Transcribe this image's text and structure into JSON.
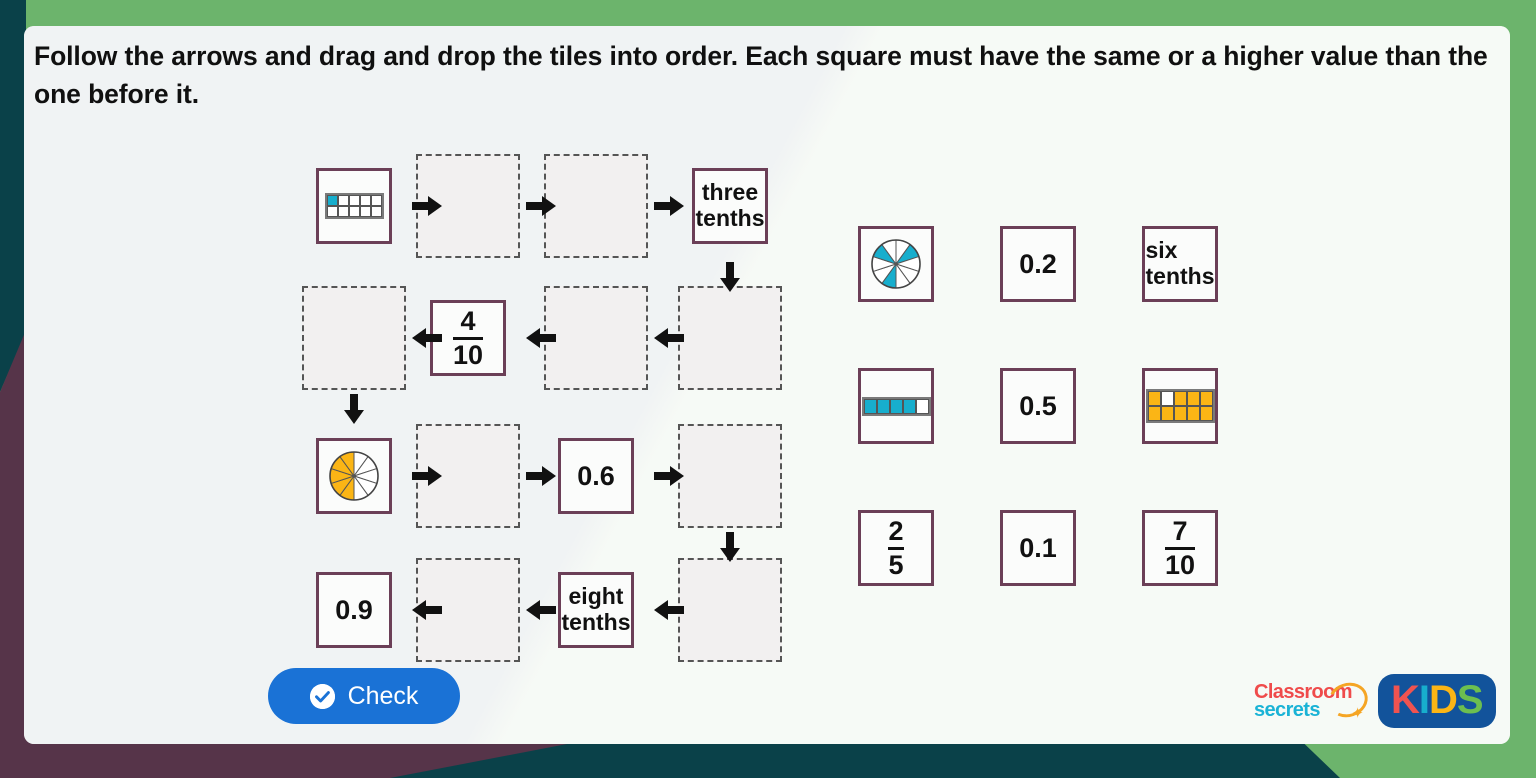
{
  "page": {
    "background_color": "#6cb46c",
    "card_color": "#f7f9f7",
    "accent_purple": "#6b3f57",
    "accent_teal": "#0a4149",
    "accent_plum": "#563449"
  },
  "instruction": {
    "text": "Follow the arrows and drag and drop the tiles into order. Each square must have the same or a higher value than the one before it."
  },
  "flow": {
    "rows": [
      {
        "direction": "right",
        "cells": [
          {
            "kind": "model-grid",
            "state": "filled",
            "model": "grid-10-cyan",
            "filled_count": 1,
            "total": 10,
            "value": "0.1"
          },
          {
            "kind": "blank",
            "state": "empty",
            "label": ""
          },
          {
            "kind": "blank",
            "state": "empty",
            "label": ""
          },
          {
            "kind": "words",
            "state": "filled",
            "label": "three tenths",
            "line1": "three",
            "line2": "tenths"
          }
        ]
      },
      {
        "direction": "left",
        "cells": [
          {
            "kind": "blank",
            "state": "empty",
            "label": ""
          },
          {
            "kind": "fraction",
            "state": "filled",
            "numerator": "4",
            "denominator": "10"
          },
          {
            "kind": "blank",
            "state": "empty",
            "label": ""
          },
          {
            "kind": "blank",
            "state": "empty",
            "label": ""
          }
        ]
      },
      {
        "direction": "right",
        "cells": [
          {
            "kind": "model-pie",
            "state": "filled",
            "model": "pie-10-orange",
            "filled_count": 5,
            "total": 10,
            "value": "0.5"
          },
          {
            "kind": "blank",
            "state": "empty",
            "label": ""
          },
          {
            "kind": "decimal",
            "state": "filled",
            "label": "0.6"
          },
          {
            "kind": "blank",
            "state": "empty",
            "label": ""
          }
        ]
      },
      {
        "direction": "left",
        "cells": [
          {
            "kind": "decimal",
            "state": "filled",
            "label": "0.9"
          },
          {
            "kind": "blank",
            "state": "empty",
            "label": ""
          },
          {
            "kind": "words",
            "state": "filled",
            "label": "eight tenths",
            "line1": "eight",
            "line2": "tenths"
          },
          {
            "kind": "blank",
            "state": "empty",
            "label": ""
          }
        ]
      }
    ]
  },
  "tile_bank": {
    "tiles": [
      {
        "kind": "model-pie",
        "model": "pie-10-cyan",
        "filled_count": 3,
        "total": 10,
        "label": "three tenths pie"
      },
      {
        "kind": "decimal",
        "label": "0.2"
      },
      {
        "kind": "words",
        "label": "six tenths",
        "line1": "six",
        "line2": "tenths"
      },
      {
        "kind": "model-bar",
        "model": "bar-5-cyan",
        "filled_count": 4,
        "total": 5,
        "label": "four fifths bar"
      },
      {
        "kind": "decimal",
        "label": "0.5"
      },
      {
        "kind": "model-grid",
        "model": "grid-10-orange",
        "filled_count": 9,
        "total": 10,
        "label": "nine tenths grid"
      },
      {
        "kind": "fraction",
        "numerator": "2",
        "denominator": "5"
      },
      {
        "kind": "decimal",
        "label": "0.1"
      },
      {
        "kind": "fraction",
        "numerator": "7",
        "denominator": "10"
      }
    ]
  },
  "check_button": {
    "label": "Check",
    "color": "#1a72d6",
    "icon": "check-circle-icon"
  },
  "logos": {
    "classroom_secrets": {
      "line1": "Classroom",
      "line2": "secrets"
    },
    "kids": {
      "k": "K",
      "i": "I",
      "d": "D",
      "s": "S"
    }
  }
}
